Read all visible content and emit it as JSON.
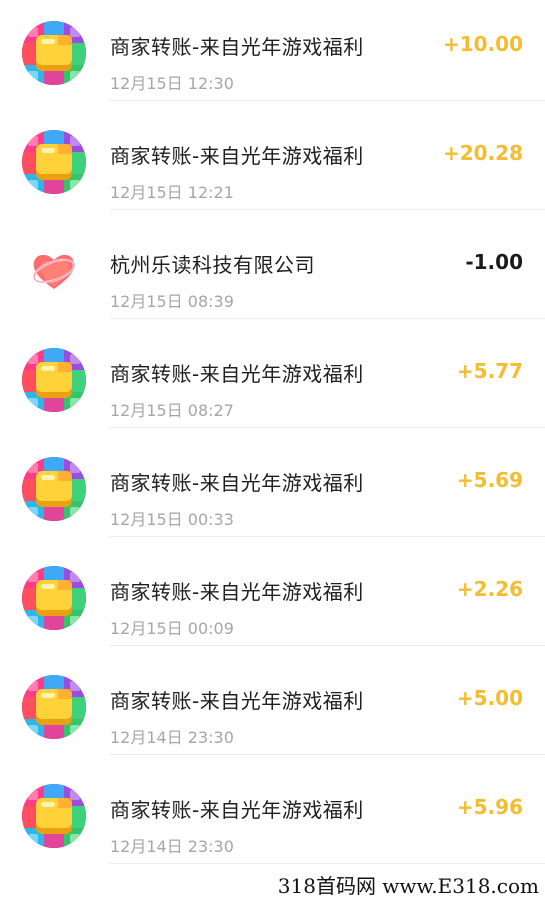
{
  "colors": {
    "income": "#f4bc2e",
    "expense": "#1a1a1a",
    "muted": "#a6a6a6"
  },
  "transactions": [
    {
      "title": "商家转账-来自光年游戏福利",
      "time": "12月15日 12:30",
      "amount": "+10.00",
      "avatar": "game-block-icon",
      "type": "income"
    },
    {
      "title": "商家转账-来自光年游戏福利",
      "time": "12月15日 12:21",
      "amount": "+20.28",
      "avatar": "game-block-icon",
      "type": "income"
    },
    {
      "title": "杭州乐读科技有限公司",
      "time": "12月15日 08:39",
      "amount": "-1.00",
      "avatar": "heart-logo-icon",
      "type": "expense"
    },
    {
      "title": "商家转账-来自光年游戏福利",
      "time": "12月15日 08:27",
      "amount": "+5.77",
      "avatar": "game-block-icon",
      "type": "income"
    },
    {
      "title": "商家转账-来自光年游戏福利",
      "time": "12月15日 00:33",
      "amount": "+5.69",
      "avatar": "game-block-icon",
      "type": "income"
    },
    {
      "title": "商家转账-来自光年游戏福利",
      "time": "12月15日 00:09",
      "amount": "+2.26",
      "avatar": "game-block-icon",
      "type": "income"
    },
    {
      "title": "商家转账-来自光年游戏福利",
      "time": "12月14日 23:30",
      "amount": "+5.00",
      "avatar": "game-block-icon",
      "type": "income"
    },
    {
      "title": "商家转账-来自光年游戏福利",
      "time": "12月14日 23:30",
      "amount": "+5.96",
      "avatar": "game-block-icon",
      "type": "income"
    }
  ],
  "watermark": "318首码网 www.E318.com"
}
